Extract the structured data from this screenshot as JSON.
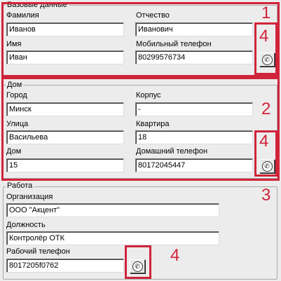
{
  "basic": {
    "title": "Базовые данные",
    "last_name_label": "Фамилия",
    "last_name_value": "Иванов",
    "patronymic_label": "Отчество",
    "patronymic_value": "Иванович",
    "first_name_label": "Имя",
    "first_name_value": "Иван",
    "mobile_label": "Мобильный телефон",
    "mobile_value": "80299576734"
  },
  "home": {
    "title": "Дом",
    "city_label": "Город",
    "city_value": "Минск",
    "building_label": "Корпус",
    "building_value": "-",
    "street_label": "Улица",
    "street_value": "Васильева",
    "apartment_label": "Квартира",
    "apartment_value": "18",
    "house_label": "Дом",
    "house_value": "15",
    "home_phone_label": "Домашний телефон",
    "home_phone_value": "80172045447"
  },
  "work": {
    "title": "Работа",
    "org_label": "Организация",
    "org_value": "ООО \"Акцент\"",
    "position_label": "Должность",
    "position_value": "Контролёр ОТК",
    "work_phone_label": "Рабочий телефон",
    "work_phone_value": "8017205f0762"
  },
  "callouts": {
    "zone1": "1",
    "zone2": "2",
    "zone3": "3",
    "phone_zone": "4"
  },
  "icons": {
    "phone_button": "phone-icon",
    "glyph": "✆"
  },
  "colors": {
    "highlight": "#d0243a",
    "background": "#ececec"
  }
}
